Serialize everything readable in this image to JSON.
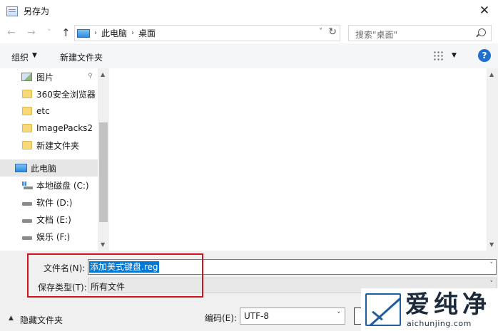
{
  "window": {
    "title": "另存为",
    "close_glyph": "✕"
  },
  "nav": {
    "back_glyph": "←",
    "forward_glyph": "→",
    "recent_glyph": "˅",
    "up_glyph": "↑",
    "breadcrumb": [
      "此电脑",
      "桌面"
    ],
    "search_placeholder": "搜索\"桌面\""
  },
  "toolbar": {
    "organize_label": "组织",
    "new_folder_label": "新建文件夹",
    "help_glyph": "?"
  },
  "sidebar": {
    "items": [
      {
        "label": "图片",
        "icon": "picture-icon",
        "pinned": true
      },
      {
        "label": "360安全浏览器",
        "icon": "folder-icon"
      },
      {
        "label": "etc",
        "icon": "folder-icon"
      },
      {
        "label": "ImagePacks2",
        "icon": "folder-icon"
      },
      {
        "label": "新建文件夹",
        "icon": "folder-icon"
      },
      {
        "label": "此电脑",
        "icon": "computer-icon",
        "selected": true
      },
      {
        "label": "本地磁盘 (C:)",
        "icon": "system-drive-icon"
      },
      {
        "label": "软件 (D:)",
        "icon": "drive-icon"
      },
      {
        "label": "文档 (E:)",
        "icon": "drive-icon"
      },
      {
        "label": "娱乐 (F:)",
        "icon": "drive-icon"
      }
    ]
  },
  "form": {
    "filename_label": "文件名(N):",
    "filename_value": "添加美式键盘.reg",
    "filetype_label": "保存类型(T):",
    "filetype_value": "所有文件",
    "hide_folders_label": "隐藏文件夹",
    "encoding_label": "编码(E):",
    "encoding_value": "UTF-8"
  },
  "watermark": {
    "cn": "爱纯净",
    "en": "aichunjing.com"
  },
  "colors": {
    "highlight": "#0078d7",
    "annotation_box": "#d0141d",
    "help": "#1f6fce"
  }
}
